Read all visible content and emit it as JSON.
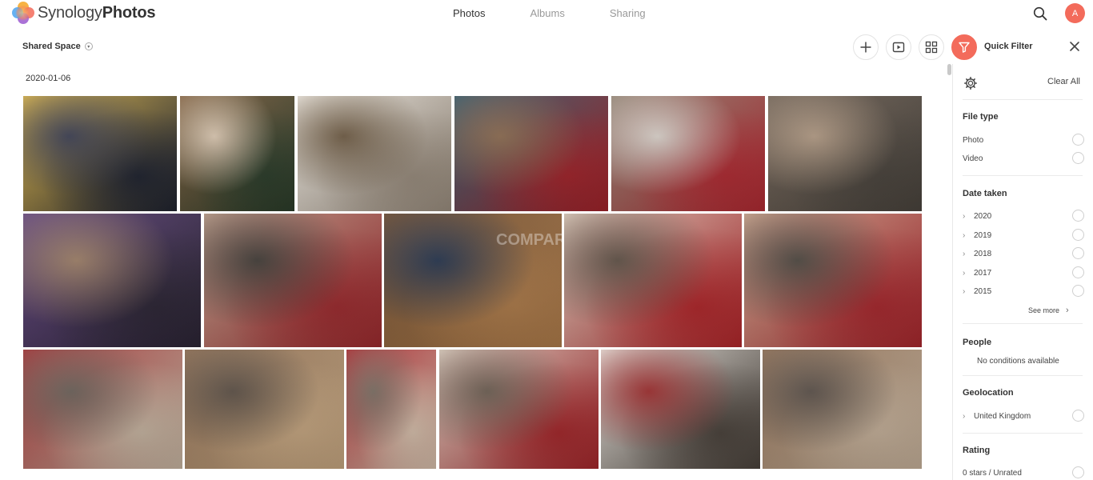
{
  "app": {
    "brand_light": "Synology",
    "brand_bold": "Photos",
    "tabs": [
      {
        "label": "Photos",
        "active": true
      },
      {
        "label": "Albums",
        "active": false
      },
      {
        "label": "Sharing",
        "active": false
      }
    ],
    "avatar_initial": "A",
    "accent_color": "#f36b5b"
  },
  "toolbar": {
    "space_label": "Shared Space",
    "quick_filter_label": "Quick Filter",
    "icons": [
      "plus-icon",
      "slideshow-icon",
      "grid-view-icon",
      "filter-icon",
      "close-icon"
    ]
  },
  "timeline": {
    "date": "2020-01-06",
    "watermark": "COMPARES",
    "photos": [
      {
        "name": "party-group",
        "colors": [
          "#d9b246",
          "#3c3f52",
          "#1f2330"
        ]
      },
      {
        "name": "christmas-selfie",
        "colors": [
          "#7b5a3a",
          "#d9c6b0",
          "#2b3d2a"
        ]
      },
      {
        "name": "cat-in-bed-by-tree",
        "colors": [
          "#e9e4dc",
          "#6d5a43",
          "#9a8d7e"
        ]
      },
      {
        "name": "cat-under-tree",
        "colors": [
          "#2f5566",
          "#8a6a4f",
          "#a3232a"
        ]
      },
      {
        "name": "cat-on-blanket",
        "colors": [
          "#8a7c6c",
          "#d7cfc8",
          "#b22a32"
        ]
      },
      {
        "name": "hand-stroking-cat",
        "colors": [
          "#6b5d51",
          "#b09983",
          "#4a443d"
        ]
      },
      {
        "name": "casino-table",
        "colors": [
          "#5c3f7a",
          "#9c7e66",
          "#2c2535"
        ]
      },
      {
        "name": "hand-on-cat-tartan",
        "colors": [
          "#b89a86",
          "#403b36",
          "#9e2a2e"
        ]
      },
      {
        "name": "man-opening-present",
        "colors": [
          "#6d4a2c",
          "#25344d",
          "#b07d4b"
        ]
      },
      {
        "name": "cat-with-toy",
        "colors": [
          "#d8c8b8",
          "#5e5045",
          "#b2262a"
        ]
      },
      {
        "name": "cat-sleeping-on-tartan",
        "colors": [
          "#c9a28a",
          "#4d4740",
          "#a9272d"
        ]
      },
      {
        "name": "cat-rolling-rug",
        "colors": [
          "#9d2c2f",
          "#6a6058",
          "#c9b7a3"
        ]
      },
      {
        "name": "cat-with-gift-1",
        "colors": [
          "#8a6a4f",
          "#5b4f45",
          "#c8a882"
        ]
      },
      {
        "name": "hand-and-cat",
        "colors": [
          "#a6262c",
          "#7a6d62",
          "#d8c1ad"
        ]
      },
      {
        "name": "cat-toy-on-head",
        "colors": [
          "#d7c9bb",
          "#6b5d51",
          "#a5262a"
        ]
      },
      {
        "name": "cat-on-bed",
        "colors": [
          "#e2ddd6",
          "#9c2d2e",
          "#4a423b"
        ]
      },
      {
        "name": "cat-with-gift-2",
        "colors": [
          "#8c6c52",
          "#5a5049",
          "#c7b29b"
        ]
      }
    ]
  },
  "quick_filter": {
    "clear_all": "Clear All",
    "file_type": {
      "title": "File type",
      "options": [
        "Photo",
        "Video"
      ]
    },
    "date_taken": {
      "title": "Date taken",
      "options": [
        "2020",
        "2019",
        "2018",
        "2017",
        "2015"
      ],
      "see_more": "See more"
    },
    "people": {
      "title": "People",
      "empty": "No conditions available"
    },
    "geolocation": {
      "title": "Geolocation",
      "options": [
        "United Kingdom"
      ]
    },
    "rating": {
      "title": "Rating",
      "options": [
        "0 stars / Unrated"
      ]
    }
  }
}
